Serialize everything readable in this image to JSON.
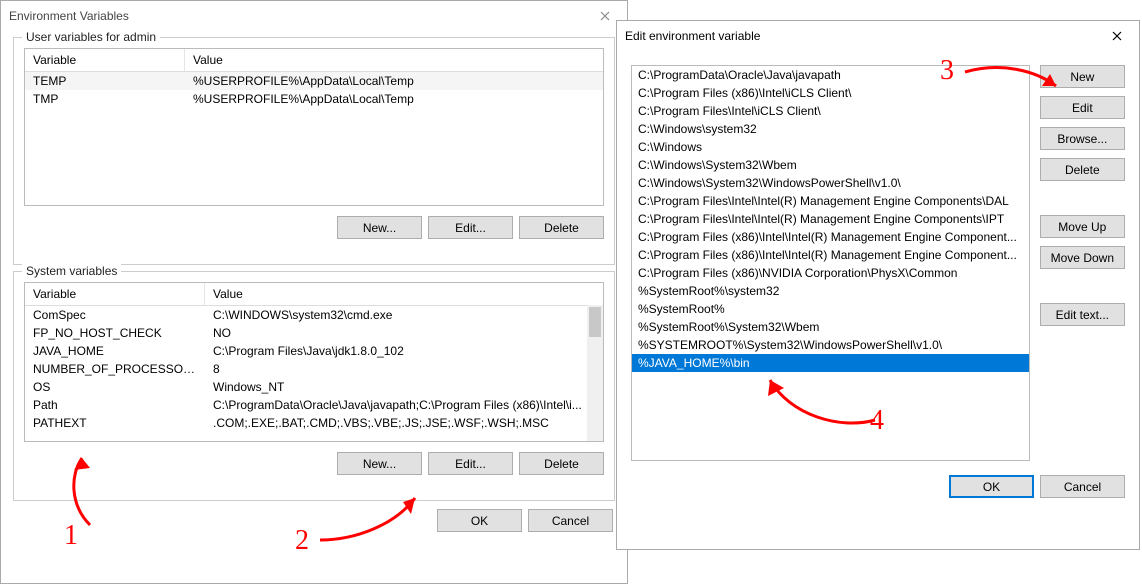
{
  "dialog1": {
    "title": "Environment Variables",
    "userGroup": {
      "legend": "User variables for admin",
      "columns": {
        "c1": "Variable",
        "c2": "Value"
      },
      "rows": [
        {
          "var": "TEMP",
          "val": "%USERPROFILE%\\AppData\\Local\\Temp"
        },
        {
          "var": "TMP",
          "val": "%USERPROFILE%\\AppData\\Local\\Temp"
        }
      ],
      "buttons": {
        "new": "New...",
        "edit": "Edit...",
        "delete": "Delete"
      }
    },
    "sysGroup": {
      "legend": "System variables",
      "columns": {
        "c1": "Variable",
        "c2": "Value"
      },
      "rows": [
        {
          "var": "ComSpec",
          "val": "C:\\WINDOWS\\system32\\cmd.exe"
        },
        {
          "var": "FP_NO_HOST_CHECK",
          "val": "NO"
        },
        {
          "var": "JAVA_HOME",
          "val": "C:\\Program Files\\Java\\jdk1.8.0_102"
        },
        {
          "var": "NUMBER_OF_PROCESSORS",
          "val": "8"
        },
        {
          "var": "OS",
          "val": "Windows_NT"
        },
        {
          "var": "Path",
          "val": "C:\\ProgramData\\Oracle\\Java\\javapath;C:\\Program Files (x86)\\Intel\\i..."
        },
        {
          "var": "PATHEXT",
          "val": ".COM;.EXE;.BAT;.CMD;.VBS;.VBE;.JS;.JSE;.WSF;.WSH;.MSC"
        }
      ],
      "buttons": {
        "new": "New...",
        "edit": "Edit...",
        "delete": "Delete"
      }
    },
    "bottom": {
      "ok": "OK",
      "cancel": "Cancel"
    }
  },
  "dialog2": {
    "title": "Edit environment variable",
    "items": [
      "C:\\ProgramData\\Oracle\\Java\\javapath",
      "C:\\Program Files (x86)\\Intel\\iCLS Client\\",
      "C:\\Program Files\\Intel\\iCLS Client\\",
      "C:\\Windows\\system32",
      "C:\\Windows",
      "C:\\Windows\\System32\\Wbem",
      "C:\\Windows\\System32\\WindowsPowerShell\\v1.0\\",
      "C:\\Program Files\\Intel\\Intel(R) Management Engine Components\\DAL",
      "C:\\Program Files\\Intel\\Intel(R) Management Engine Components\\IPT",
      "C:\\Program Files (x86)\\Intel\\Intel(R) Management Engine Component...",
      "C:\\Program Files (x86)\\Intel\\Intel(R) Management Engine Component...",
      "C:\\Program Files (x86)\\NVIDIA Corporation\\PhysX\\Common",
      "%SystemRoot%\\system32",
      "%SystemRoot%",
      "%SystemRoot%\\System32\\Wbem",
      "%SYSTEMROOT%\\System32\\WindowsPowerShell\\v1.0\\",
      "%JAVA_HOME%\\bin"
    ],
    "selected": 16,
    "buttons": {
      "new": "New",
      "edit": "Edit",
      "browse": "Browse...",
      "delete": "Delete",
      "moveup": "Move Up",
      "movedown": "Move Down",
      "edittext": "Edit text..."
    },
    "bottom": {
      "ok": "OK",
      "cancel": "Cancel"
    }
  },
  "anno": {
    "n1": "1",
    "n2": "2",
    "n3": "3",
    "n4": "4"
  }
}
